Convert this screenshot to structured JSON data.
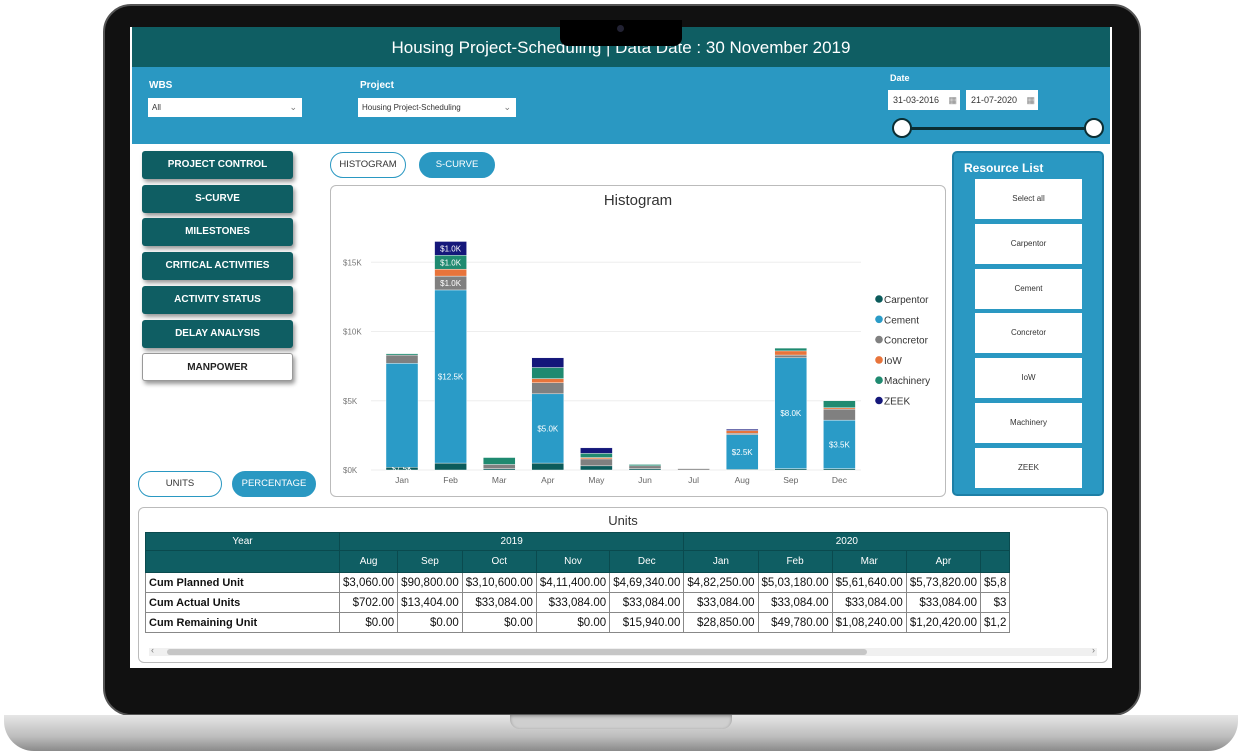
{
  "header": {
    "title": "Housing Project-Scheduling | Data Date : 30 November 2019"
  },
  "filters": {
    "wbs_label": "WBS",
    "wbs_value": "All",
    "project_label": "Project",
    "project_value": "Housing Project-Scheduling",
    "date_label": "Date",
    "date_start": "31-03-2016",
    "date_end": "21-07-2020",
    "date_range_fraction": [
      0,
      1
    ]
  },
  "nav": [
    "PROJECT CONTROL",
    "S-CURVE",
    "MILESTONES",
    "CRITICAL ACTIVITIES",
    "ACTIVITY STATUS",
    "DELAY ANALYSIS",
    "MANPOWER"
  ],
  "nav_active": "MANPOWER",
  "toggles": {
    "histogram": "HISTOGRAM",
    "scurve": "S-CURVE",
    "units": "UNITS",
    "percentage": "PERCENTAGE"
  },
  "resource_list": {
    "title": "Resource List",
    "items": [
      "Select all",
      "Carpentor",
      "Cement",
      "Concretor",
      "IoW",
      "Machinery",
      "ZEEK"
    ]
  },
  "chart_data": {
    "type": "bar",
    "stacked": true,
    "title": "Histogram",
    "categories": [
      "Jan",
      "Feb",
      "Mar",
      "Apr",
      "May",
      "Jun",
      "Jul",
      "Aug",
      "Sep",
      "Dec"
    ],
    "yticks": [
      "$0K",
      "$5K",
      "$10K",
      "$15K"
    ],
    "ylim": [
      0,
      17
    ],
    "unit": "$K",
    "legend": "right",
    "series": [
      {
        "name": "Carpentor",
        "color": "#0b5b5b",
        "values": [
          0.2,
          0.5,
          0.1,
          0.5,
          0.3,
          0.1,
          0,
          0.05,
          0.1,
          0.1
        ]
      },
      {
        "name": "Cement",
        "color": "#2a9bc7",
        "values": [
          7.5,
          12.5,
          0,
          5.0,
          0,
          0,
          0,
          2.5,
          8.0,
          3.5
        ]
      },
      {
        "name": "Concretor",
        "color": "#808080",
        "values": [
          0.6,
          1.0,
          0.3,
          0.8,
          0.5,
          0.2,
          0.1,
          0.1,
          0.2,
          0.8
        ]
      },
      {
        "name": "IoW",
        "color": "#e8743b",
        "values": [
          0,
          0.5,
          0,
          0.3,
          0.1,
          0,
          0,
          0.2,
          0.3,
          0.1
        ]
      },
      {
        "name": "Machinery",
        "color": "#1f8a70",
        "values": [
          0.1,
          1.0,
          0.5,
          0.8,
          0.3,
          0.1,
          0,
          0,
          0.2,
          0.5
        ]
      },
      {
        "name": "ZEEK",
        "color": "#14177a",
        "values": [
          0,
          1.0,
          0,
          0.7,
          0.4,
          0,
          0,
          0.1,
          0,
          0
        ]
      }
    ],
    "data_labels": [
      [
        "$7.5K",
        null,
        null,
        null,
        null,
        null
      ],
      [
        null,
        "$12.5K",
        "$1.0K",
        null,
        "$1.0K",
        "$1.0K"
      ],
      [],
      [
        null,
        "$5.0K"
      ],
      [],
      [],
      [],
      [
        null,
        "$2.5K"
      ],
      [
        null,
        "$8.0K"
      ],
      [
        null,
        "$3.5K"
      ]
    ]
  },
  "table": {
    "title": "Units",
    "year_label": "Year",
    "years": [
      {
        "label": "2019",
        "span": 5
      },
      {
        "label": "2020",
        "span": 5
      }
    ],
    "months": [
      "Aug",
      "Sep",
      "Oct",
      "Nov",
      "Dec",
      "Jan",
      "Feb",
      "Mar",
      "Apr",
      ""
    ],
    "rows": [
      {
        "label": "Cum Planned Unit",
        "values": [
          "$3,060.00",
          "$90,800.00",
          "$3,10,600.00",
          "$4,11,400.00",
          "$4,69,340.00",
          "$4,82,250.00",
          "$5,03,180.00",
          "$5,61,640.00",
          "$5,73,820.00",
          "$5,8"
        ]
      },
      {
        "label": "Cum Actual Units",
        "values": [
          "$702.00",
          "$13,404.00",
          "$33,084.00",
          "$33,084.00",
          "$33,084.00",
          "$33,084.00",
          "$33,084.00",
          "$33,084.00",
          "$33,084.00",
          "$3"
        ]
      },
      {
        "label": "Cum Remaining Unit",
        "values": [
          "$0.00",
          "$0.00",
          "$0.00",
          "$0.00",
          "$15,940.00",
          "$28,850.00",
          "$49,780.00",
          "$1,08,240.00",
          "$1,20,420.00",
          "$1,2"
        ]
      }
    ]
  }
}
